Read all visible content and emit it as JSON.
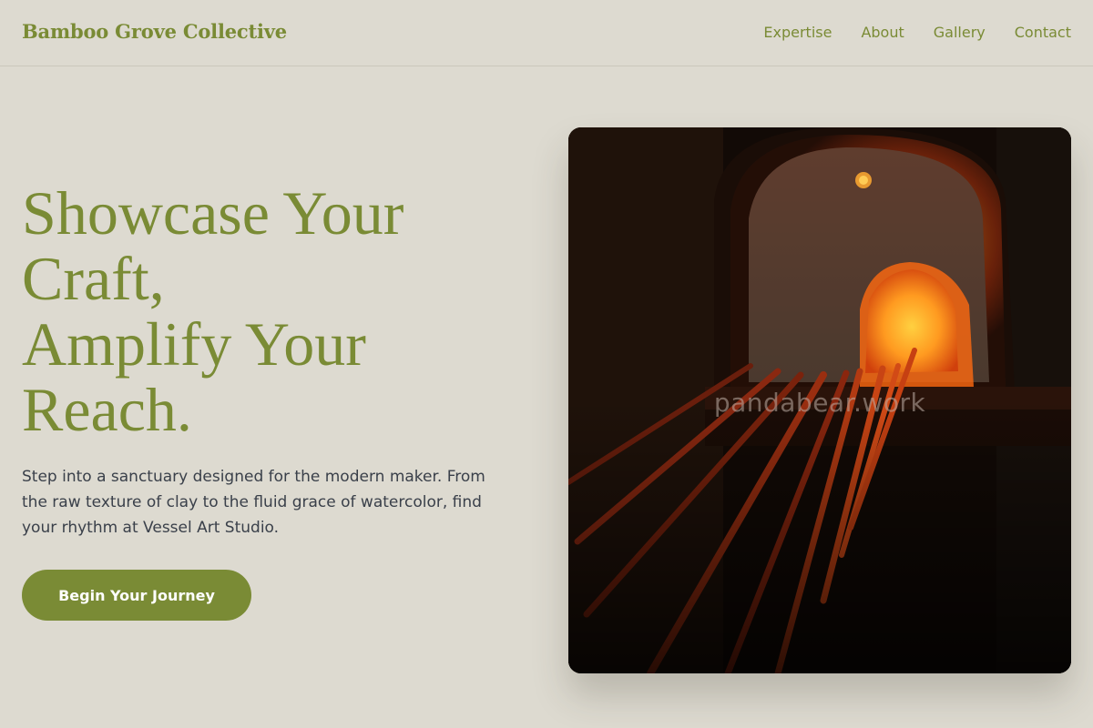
{
  "header": {
    "brand": "Bamboo Grove Collective",
    "nav": [
      "Expertise",
      "About",
      "Gallery",
      "Contact"
    ]
  },
  "hero": {
    "headline_lines": [
      "Showcase Your",
      "Craft,",
      "Amplify Your",
      "Reach."
    ],
    "lede": "Step into a sanctuary designed for the modern maker. From the raw texture of clay to the fluid grace of watercolor, find your rhythm at Vessel Art Studio.",
    "cta_label": "Begin Your Journey"
  },
  "image": {
    "subject": "glass furnace glowing with metal rods",
    "watermark": "pandabear.work"
  },
  "colors": {
    "background": "#dddad0",
    "accent": "#7a8b35",
    "body_text": "#3a404a",
    "button_text": "#ffffff"
  }
}
